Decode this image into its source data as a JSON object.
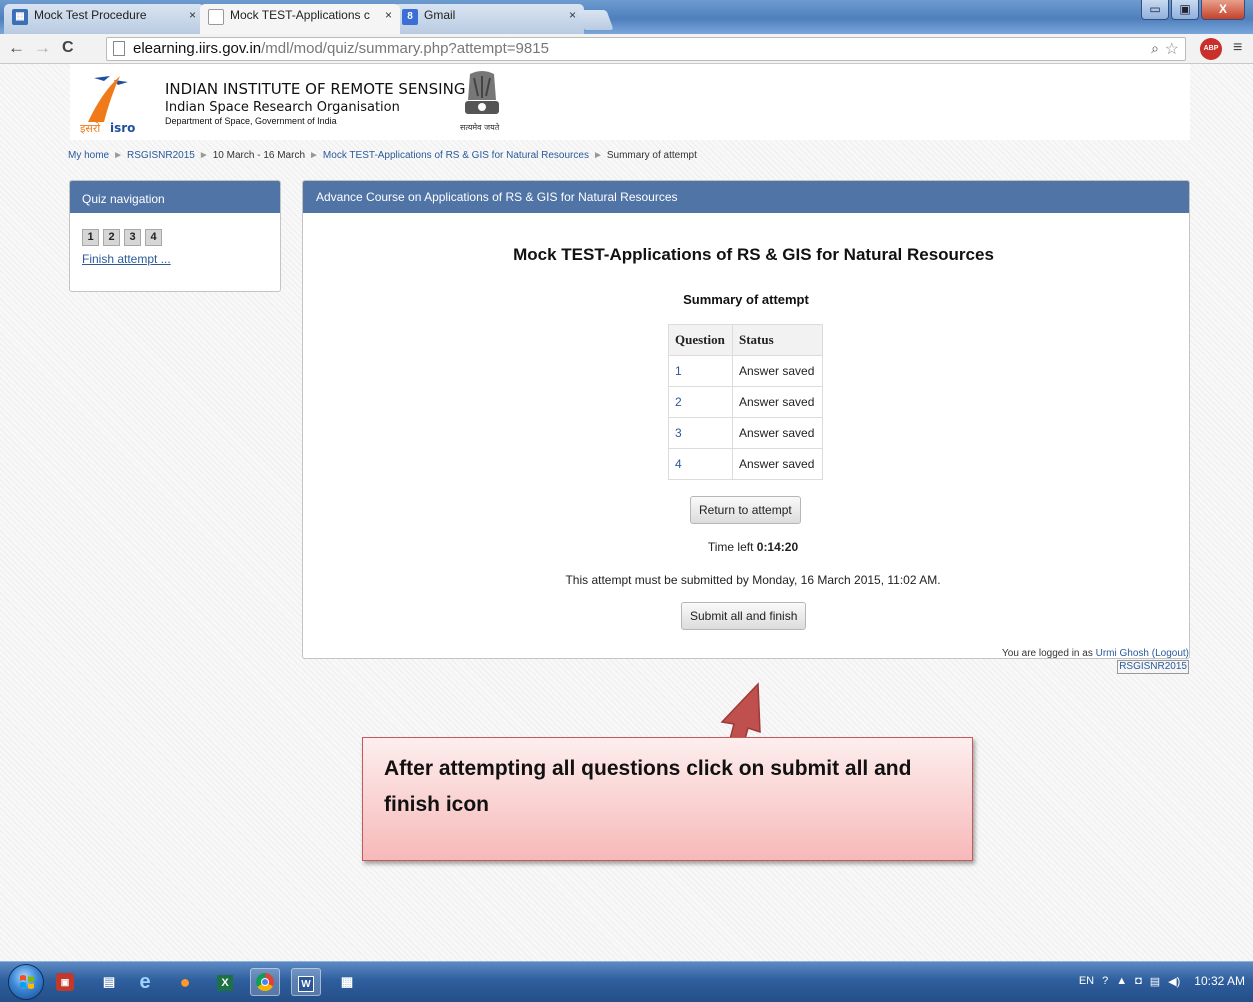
{
  "browser": {
    "tabs": [
      {
        "title": "Mock Test Procedure",
        "close": "×",
        "icon": "table-icon"
      },
      {
        "title": "Mock TEST-Applications c",
        "close": "×",
        "icon": "page-icon"
      },
      {
        "title": "Gmail",
        "close": "×",
        "icon": "google-icon"
      }
    ],
    "url_host": "elearning.iirs.gov.in",
    "url_path": "/mdl/mod/quiz/summary.php?attempt=9815",
    "back": "←",
    "forward": "→",
    "reload": "C",
    "zoom_glyph": "⌕",
    "star_glyph": "☆",
    "menu_glyph": "≡",
    "abp_label": "ABP",
    "window_buttons": [
      "▭",
      "▣",
      "X"
    ]
  },
  "header": {
    "org_name": "INDIAN INSTITUTE OF REMOTE SENSING",
    "parent_org": "Indian Space Research Organisation",
    "department": "Department of Space, Government of India",
    "isro_hindi": "इसरो",
    "isro_latin": "isro",
    "emblem_motto": "सत्यमेव जयते"
  },
  "breadcrumb": {
    "items": [
      "My home",
      "RSGISNR2015",
      "10 March - 16 March",
      "Mock TEST-Applications of RS & GIS for Natural Resources",
      "Summary of attempt"
    ],
    "separator": "►"
  },
  "quiz_nav": {
    "heading": "Quiz navigation",
    "questions": [
      "1",
      "2",
      "3",
      "4"
    ],
    "finish_link": "Finish attempt ..."
  },
  "main": {
    "course_heading": "Advance Course on Applications of RS & GIS for Natural Resources",
    "quiz_title": "Mock TEST-Applications of RS & GIS for Natural Resources",
    "summary_title": "Summary of attempt",
    "table": {
      "headers": [
        "Question",
        "Status"
      ],
      "rows": [
        {
          "q": "1",
          "status": "Answer saved"
        },
        {
          "q": "2",
          "status": "Answer saved"
        },
        {
          "q": "3",
          "status": "Answer saved"
        },
        {
          "q": "4",
          "status": "Answer saved"
        }
      ]
    },
    "return_button": "Return to attempt",
    "time_left_label": "Time left",
    "time_left_value": "0:14:20",
    "deadline": "This attempt must be submitted by Monday, 16 March 2015, 11:02 AM.",
    "submit_button": "Submit all and finish"
  },
  "login": {
    "prefix": "You are logged in as",
    "user": "Urmi Ghosh",
    "logout": "(Logout)",
    "course": "RSGISNR2015"
  },
  "callout": {
    "text": "After attempting all questions click on submit all and finish icon",
    "color": "#c0504d"
  },
  "taskbar": {
    "icons": [
      "pdf-icon",
      "folder-icon",
      "ie-icon",
      "firefox-icon",
      "excel-icon",
      "chrome-icon",
      "word-icon",
      "explorer-icon"
    ],
    "tray_lang": "EN",
    "clock": "10:32 AM"
  }
}
